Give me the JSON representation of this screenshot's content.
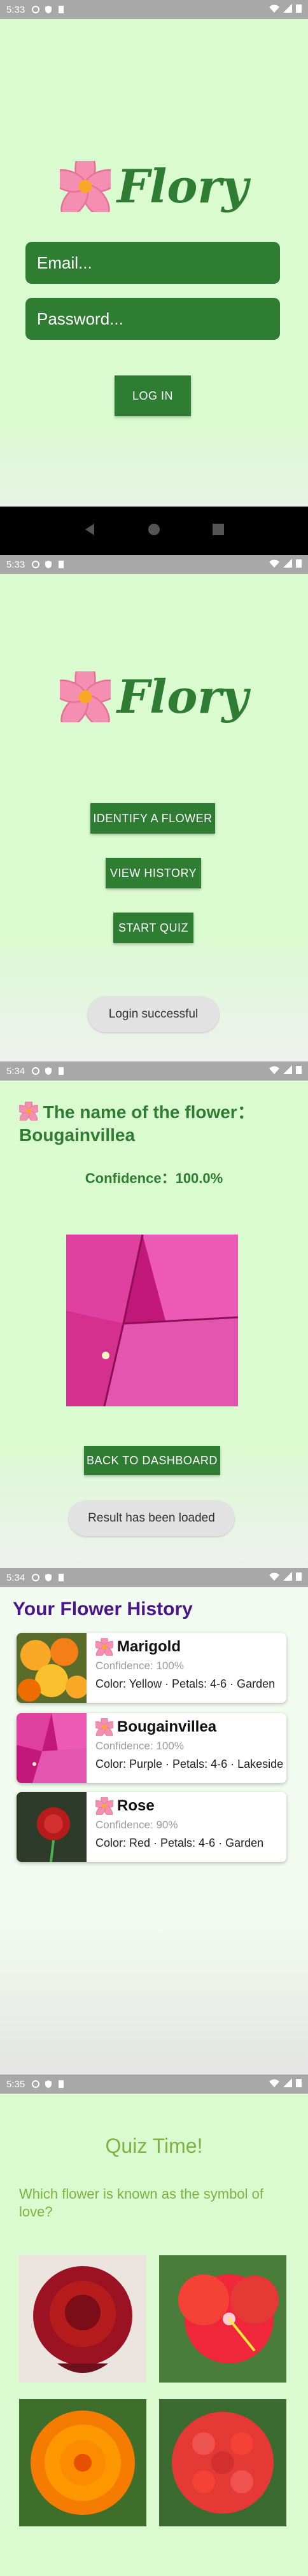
{
  "status": {
    "s1_time": "5:33",
    "s2_time": "5:33",
    "s3_time": "5:34",
    "s4_time": "5:34",
    "s5_time": "5:35"
  },
  "app": {
    "name": "Flory"
  },
  "login": {
    "email_placeholder": "Email...",
    "password_placeholder": "Password...",
    "login_label": "LOG IN"
  },
  "dashboard": {
    "identify_label": "IDENTIFY A FLOWER",
    "history_label": "VIEW HISTORY",
    "quiz_label": "START QUIZ",
    "toast": "Login successful"
  },
  "result": {
    "heading_prefix": "The name of the flower：",
    "flower_name": "Bougainvillea",
    "confidence_label": "Confidence：",
    "confidence_value": "100.0%",
    "back_label": "BACK TO DASHBOARD",
    "toast": "Result has been loaded"
  },
  "history": {
    "title": "Your Flower History",
    "items": [
      {
        "name": "Marigold",
        "confidence": "Confidence: 100%",
        "meta": "Color: Yellow · Petals: 4-6 · Garden"
      },
      {
        "name": "Bougainvillea",
        "confidence": "Confidence: 100%",
        "meta": "Color: Purple · Petals: 4-6 · Lakeside"
      },
      {
        "name": "Rose",
        "confidence": "Confidence: 90%",
        "meta": "Color: Red · Petals: 4-6 · Garden"
      }
    ]
  },
  "quiz": {
    "title": "Quiz Time!",
    "question": "Which flower is known as the symbol of love?"
  },
  "colors": {
    "primary_green": "#2e7d32",
    "bg_green": "#d9fbcf",
    "history_title": "#4a148c",
    "quiz_text": "#7cb342"
  }
}
